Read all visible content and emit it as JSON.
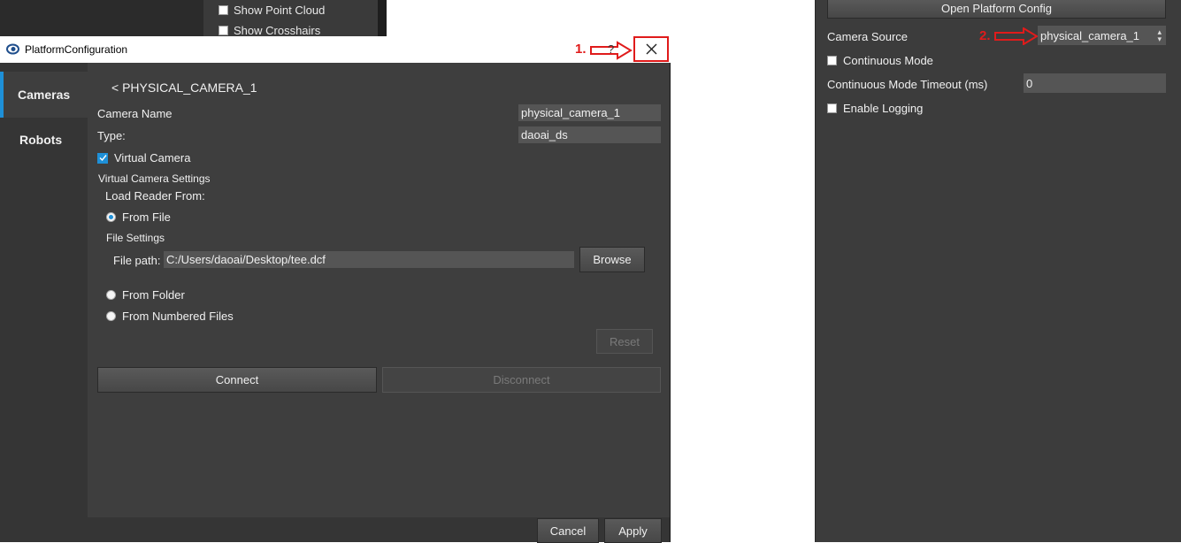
{
  "background_panel": {
    "show_point_cloud": "Show Point Cloud",
    "show_crosshairs": "Show Crosshairs"
  },
  "right_panel": {
    "open_platform_config": "Open Platform Config",
    "camera_source_label": "Camera Source",
    "camera_source_value": "physical_camera_1",
    "continuous_mode": "Continuous Mode",
    "continuous_mode_timeout_label": "Continuous Mode Timeout (ms)",
    "continuous_mode_timeout_value": "0",
    "enable_logging": "Enable Logging"
  },
  "dialog": {
    "title": "PlatformConfiguration",
    "help": "?",
    "sidebar": [
      {
        "label": "Cameras",
        "active": true
      },
      {
        "label": "Robots",
        "active": false
      }
    ],
    "back_title": "< PHYSICAL_CAMERA_1",
    "camera_name_label": "Camera Name",
    "camera_name_value": "physical_camera_1",
    "type_label": "Type:",
    "type_value": "daoai_ds",
    "virtual_camera_label": "Virtual Camera",
    "virtual_camera_settings": "Virtual Camera Settings",
    "load_reader_from": "Load Reader From:",
    "from_file": "From File",
    "file_settings": "File Settings",
    "file_path_label": "File path:",
    "file_path_value": "C:/Users/daoai/Desktop/tee.dcf",
    "browse": "Browse",
    "from_folder": "From Folder",
    "from_numbered_files": "From Numbered Files",
    "reset": "Reset",
    "connect": "Connect",
    "disconnect": "Disconnect",
    "cancel": "Cancel",
    "apply": "Apply"
  },
  "annotations": {
    "step1": "1.",
    "step2": "2.",
    "color": "#e01b1b"
  }
}
